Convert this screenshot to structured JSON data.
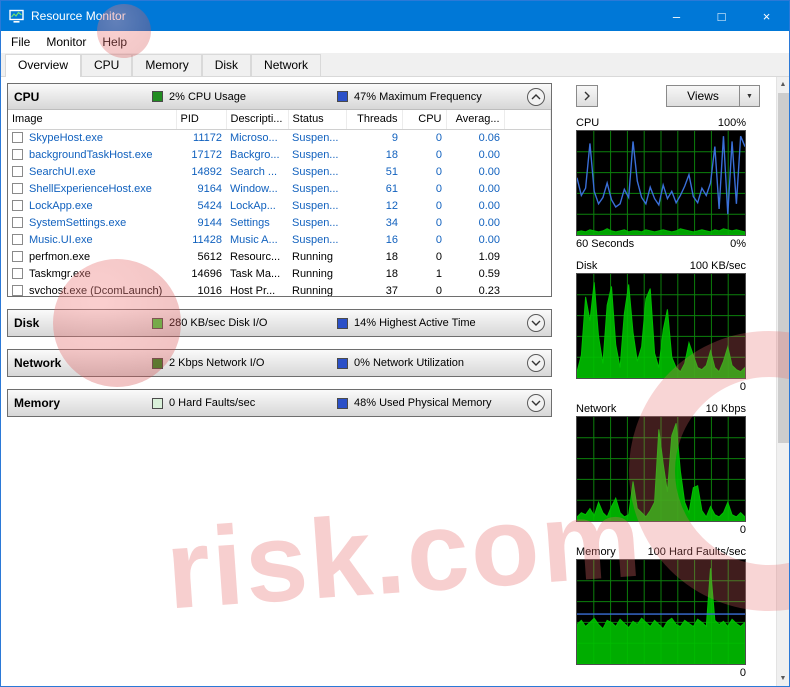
{
  "window": {
    "title": "Resource Monitor",
    "controls": {
      "minimize": "–",
      "maximize": "□",
      "close": "×"
    }
  },
  "menu": {
    "items": [
      "File",
      "Monitor",
      "Help"
    ]
  },
  "tabs": {
    "items": [
      "Overview",
      "CPU",
      "Memory",
      "Disk",
      "Network"
    ],
    "active": "Overview"
  },
  "sections": {
    "cpu": {
      "title": "CPU",
      "stats": [
        {
          "label": "2% CPU Usage",
          "color": "#218c21"
        },
        {
          "label": "47% Maximum Frequency",
          "color": "#2b50c8"
        }
      ],
      "table": {
        "headers": [
          "Image",
          "PID",
          "Descripti...",
          "Status",
          "Threads",
          "CPU",
          "Averag..."
        ],
        "rows": [
          {
            "image": "SkypeHost.exe",
            "pid": "11172",
            "description": "Microso...",
            "status": "Suspen...",
            "threads": "9",
            "cpu": "0",
            "average": "0.06",
            "running": false
          },
          {
            "image": "backgroundTaskHost.exe",
            "pid": "17172",
            "description": "Backgro...",
            "status": "Suspen...",
            "threads": "18",
            "cpu": "0",
            "average": "0.00",
            "running": false
          },
          {
            "image": "SearchUI.exe",
            "pid": "14892",
            "description": "Search ...",
            "status": "Suspen...",
            "threads": "51",
            "cpu": "0",
            "average": "0.00",
            "running": false
          },
          {
            "image": "ShellExperienceHost.exe",
            "pid": "9164",
            "description": "Window...",
            "status": "Suspen...",
            "threads": "61",
            "cpu": "0",
            "average": "0.00",
            "running": false
          },
          {
            "image": "LockApp.exe",
            "pid": "5424",
            "description": "LockAp...",
            "status": "Suspen...",
            "threads": "12",
            "cpu": "0",
            "average": "0.00",
            "running": false
          },
          {
            "image": "SystemSettings.exe",
            "pid": "9144",
            "description": "Settings",
            "status": "Suspen...",
            "threads": "34",
            "cpu": "0",
            "average": "0.00",
            "running": false
          },
          {
            "image": "Music.UI.exe",
            "pid": "11428",
            "description": "Music A...",
            "status": "Suspen...",
            "threads": "16",
            "cpu": "0",
            "average": "0.00",
            "running": false
          },
          {
            "image": "perfmon.exe",
            "pid": "5612",
            "description": "Resourc...",
            "status": "Running",
            "threads": "18",
            "cpu": "0",
            "average": "1.09",
            "running": true
          },
          {
            "image": "Taskmgr.exe",
            "pid": "14696",
            "description": "Task Ma...",
            "status": "Running",
            "threads": "18",
            "cpu": "1",
            "average": "0.59",
            "running": true
          },
          {
            "image": "svchost.exe (DcomLaunch)",
            "pid": "1016",
            "description": "Host Pr...",
            "status": "Running",
            "threads": "37",
            "cpu": "0",
            "average": "0.23",
            "running": true
          }
        ]
      }
    },
    "disk": {
      "title": "Disk",
      "stats": [
        {
          "label": "280 KB/sec Disk I/O",
          "color": "#3bd23b"
        },
        {
          "label": "14% Highest Active Time",
          "color": "#2b50c8"
        }
      ]
    },
    "network": {
      "title": "Network",
      "stats": [
        {
          "label": "2 Kbps Network I/O",
          "color": "#218c21"
        },
        {
          "label": "0% Network Utilization",
          "color": "#2b50c8"
        }
      ]
    },
    "memory": {
      "title": "Memory",
      "stats": [
        {
          "label": "0 Hard Faults/sec",
          "color": "#d9f0d9"
        },
        {
          "label": "48% Used Physical Memory",
          "color": "#2b50c8"
        }
      ]
    }
  },
  "right_panel": {
    "views_label": "Views",
    "views_arrow": "▼",
    "scroll_up": "▲",
    "scroll_down": "▼",
    "graphs": [
      {
        "title": "CPU",
        "max_label": "100%",
        "footer_left": "60 Seconds",
        "footer_right": "0%",
        "series": [
          {
            "type": "area",
            "color": "#00b400",
            "values": [
              3,
              4,
              3,
              5,
              4,
              3,
              4,
              6,
              4,
              3,
              4,
              5,
              3,
              4,
              4,
              3,
              5,
              4,
              3,
              4,
              5,
              4,
              3,
              4,
              6,
              5,
              4,
              3,
              4,
              5,
              4,
              3,
              5,
              4,
              6,
              5,
              4,
              5,
              4,
              3
            ]
          },
          {
            "type": "line",
            "color": "#3a6fd8",
            "values": [
              55,
              38,
              45,
              88,
              42,
              30,
              36,
              50,
              34,
              27,
              30,
              44,
              36,
              90,
              52,
              36,
              30,
              46,
              35,
              29,
              48,
              35,
              42,
              31,
              38,
              47,
              58,
              37,
              31,
              45,
              38,
              50,
              85,
              25,
              95,
              20,
              90,
              30,
              95,
              85
            ]
          }
        ]
      },
      {
        "title": "Disk",
        "max_label": "100 KB/sec",
        "footer_left": "",
        "footer_right": "0",
        "series": [
          {
            "type": "area",
            "color": "#00c000",
            "values": [
              6,
              22,
              78,
              55,
              92,
              40,
              14,
              70,
              88,
              32,
              10,
              62,
              90,
              44,
              16,
              30,
              76,
              86,
              24,
              10,
              46,
              66,
              20,
              10,
              6,
              14,
              34,
              22,
              10,
              8,
              12,
              26,
              10,
              6,
              16,
              30,
              12,
              8,
              6,
              10
            ]
          }
        ]
      },
      {
        "title": "Network",
        "max_label": "10 Kbps",
        "footer_left": "",
        "footer_right": "0",
        "series": [
          {
            "type": "area",
            "color": "#00c000",
            "values": [
              4,
              8,
              6,
              12,
              5,
              18,
              8,
              4,
              14,
              22,
              8,
              4,
              6,
              38,
              12,
              8,
              4,
              10,
              18,
              88,
              55,
              28,
              82,
              94,
              48,
              18,
              8,
              32,
              34,
              10,
              4,
              14,
              6,
              4,
              8,
              18,
              6,
              4,
              8,
              4
            ]
          }
        ]
      },
      {
        "title": "Memory",
        "max_label": "100 Hard Faults/sec",
        "footer_left": "",
        "footer_right": "0",
        "series": [
          {
            "type": "area",
            "color": "#00c000",
            "values": [
              38,
              42,
              36,
              40,
              44,
              38,
              34,
              42,
              40,
              36,
              43,
              39,
              35,
              41,
              38,
              44,
              40,
              36,
              42,
              38,
              34,
              41,
              44,
              38,
              36,
              42,
              39,
              36,
              43,
              40,
              36,
              92,
              42,
              38,
              41,
              36,
              43,
              39,
              36,
              40
            ]
          },
          {
            "type": "line",
            "color": "#3a6fd8",
            "values": [
              48,
              48,
              48,
              48,
              48,
              48,
              48,
              48,
              48,
              48,
              48,
              48,
              48,
              48,
              48,
              48,
              48,
              48,
              48,
              48,
              48,
              48,
              48,
              48,
              48,
              48,
              48,
              48,
              48,
              48,
              48,
              48,
              48,
              48,
              48,
              48,
              48,
              48,
              48,
              48
            ]
          }
        ]
      }
    ]
  },
  "watermark": {
    "text": "risk.com"
  }
}
